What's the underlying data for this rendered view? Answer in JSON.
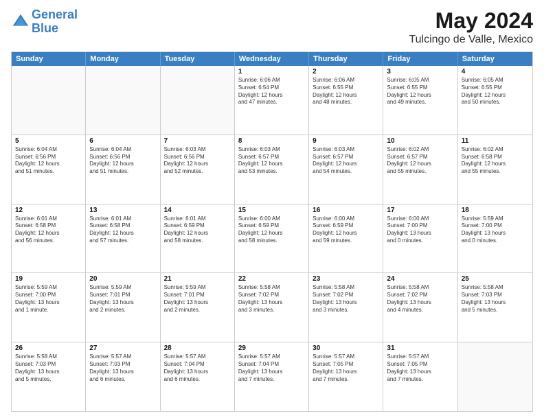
{
  "logo": {
    "line1": "General",
    "line2": "Blue"
  },
  "title": "May 2024",
  "subtitle": "Tulcingo de Valle, Mexico",
  "header": {
    "days": [
      "Sunday",
      "Monday",
      "Tuesday",
      "Wednesday",
      "Thursday",
      "Friday",
      "Saturday"
    ]
  },
  "weeks": [
    [
      {
        "day": "",
        "text": ""
      },
      {
        "day": "",
        "text": ""
      },
      {
        "day": "",
        "text": ""
      },
      {
        "day": "1",
        "text": "Sunrise: 6:06 AM\nSunset: 6:54 PM\nDaylight: 12 hours\nand 47 minutes."
      },
      {
        "day": "2",
        "text": "Sunrise: 6:06 AM\nSunset: 6:55 PM\nDaylight: 12 hours\nand 48 minutes."
      },
      {
        "day": "3",
        "text": "Sunrise: 6:05 AM\nSunset: 6:55 PM\nDaylight: 12 hours\nand 49 minutes."
      },
      {
        "day": "4",
        "text": "Sunrise: 6:05 AM\nSunset: 6:55 PM\nDaylight: 12 hours\nand 50 minutes."
      }
    ],
    [
      {
        "day": "5",
        "text": "Sunrise: 6:04 AM\nSunset: 6:56 PM\nDaylight: 12 hours\nand 51 minutes."
      },
      {
        "day": "6",
        "text": "Sunrise: 6:04 AM\nSunset: 6:56 PM\nDaylight: 12 hours\nand 51 minutes."
      },
      {
        "day": "7",
        "text": "Sunrise: 6:03 AM\nSunset: 6:56 PM\nDaylight: 12 hours\nand 52 minutes."
      },
      {
        "day": "8",
        "text": "Sunrise: 6:03 AM\nSunset: 6:57 PM\nDaylight: 12 hours\nand 53 minutes."
      },
      {
        "day": "9",
        "text": "Sunrise: 6:03 AM\nSunset: 6:57 PM\nDaylight: 12 hours\nand 54 minutes."
      },
      {
        "day": "10",
        "text": "Sunrise: 6:02 AM\nSunset: 6:57 PM\nDaylight: 12 hours\nand 55 minutes."
      },
      {
        "day": "11",
        "text": "Sunrise: 6:02 AM\nSunset: 6:58 PM\nDaylight: 12 hours\nand 55 minutes."
      }
    ],
    [
      {
        "day": "12",
        "text": "Sunrise: 6:01 AM\nSunset: 6:58 PM\nDaylight: 12 hours\nand 56 minutes."
      },
      {
        "day": "13",
        "text": "Sunrise: 6:01 AM\nSunset: 6:58 PM\nDaylight: 12 hours\nand 57 minutes."
      },
      {
        "day": "14",
        "text": "Sunrise: 6:01 AM\nSunset: 6:59 PM\nDaylight: 12 hours\nand 58 minutes."
      },
      {
        "day": "15",
        "text": "Sunrise: 6:00 AM\nSunset: 6:59 PM\nDaylight: 12 hours\nand 58 minutes."
      },
      {
        "day": "16",
        "text": "Sunrise: 6:00 AM\nSunset: 6:59 PM\nDaylight: 12 hours\nand 59 minutes."
      },
      {
        "day": "17",
        "text": "Sunrise: 6:00 AM\nSunset: 7:00 PM\nDaylight: 13 hours\nand 0 minutes."
      },
      {
        "day": "18",
        "text": "Sunrise: 5:59 AM\nSunset: 7:00 PM\nDaylight: 13 hours\nand 0 minutes."
      }
    ],
    [
      {
        "day": "19",
        "text": "Sunrise: 5:59 AM\nSunset: 7:00 PM\nDaylight: 13 hours\nand 1 minute."
      },
      {
        "day": "20",
        "text": "Sunrise: 5:59 AM\nSunset: 7:01 PM\nDaylight: 13 hours\nand 2 minutes."
      },
      {
        "day": "21",
        "text": "Sunrise: 5:59 AM\nSunset: 7:01 PM\nDaylight: 13 hours\nand 2 minutes."
      },
      {
        "day": "22",
        "text": "Sunrise: 5:58 AM\nSunset: 7:02 PM\nDaylight: 13 hours\nand 3 minutes."
      },
      {
        "day": "23",
        "text": "Sunrise: 5:58 AM\nSunset: 7:02 PM\nDaylight: 13 hours\nand 3 minutes."
      },
      {
        "day": "24",
        "text": "Sunrise: 5:58 AM\nSunset: 7:02 PM\nDaylight: 13 hours\nand 4 minutes."
      },
      {
        "day": "25",
        "text": "Sunrise: 5:58 AM\nSunset: 7:03 PM\nDaylight: 13 hours\nand 5 minutes."
      }
    ],
    [
      {
        "day": "26",
        "text": "Sunrise: 5:58 AM\nSunset: 7:03 PM\nDaylight: 13 hours\nand 5 minutes."
      },
      {
        "day": "27",
        "text": "Sunrise: 5:57 AM\nSunset: 7:03 PM\nDaylight: 13 hours\nand 6 minutes."
      },
      {
        "day": "28",
        "text": "Sunrise: 5:57 AM\nSunset: 7:04 PM\nDaylight: 13 hours\nand 6 minutes."
      },
      {
        "day": "29",
        "text": "Sunrise: 5:57 AM\nSunset: 7:04 PM\nDaylight: 13 hours\nand 7 minutes."
      },
      {
        "day": "30",
        "text": "Sunrise: 5:57 AM\nSunset: 7:05 PM\nDaylight: 13 hours\nand 7 minutes."
      },
      {
        "day": "31",
        "text": "Sunrise: 5:57 AM\nSunset: 7:05 PM\nDaylight: 13 hours\nand 7 minutes."
      },
      {
        "day": "",
        "text": ""
      }
    ]
  ]
}
